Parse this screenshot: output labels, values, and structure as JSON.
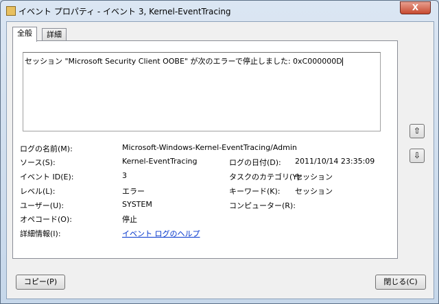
{
  "window": {
    "title": "イベント プロパティ - イベント 3, Kernel-EventTracing",
    "close": "X"
  },
  "tabs": [
    {
      "label": "全般"
    },
    {
      "label": "詳細"
    }
  ],
  "message": "セッション \"Microsoft Security Client OOBE\" が次のエラーで停止しました: 0xC000000D",
  "fields": {
    "log_name": {
      "label": "ログの名前(M):",
      "value": "Microsoft-Windows-Kernel-EventTracing/Admin"
    },
    "source": {
      "label": "ソース(S):",
      "value": "Kernel-EventTracing"
    },
    "logged": {
      "label": "ログの日付(D):",
      "value": "2011/10/14 23:35:09"
    },
    "event_id": {
      "label": "イベント ID(E):",
      "value": "3"
    },
    "task": {
      "label": "タスクのカテゴリ(Y):",
      "value": "セッション"
    },
    "level": {
      "label": "レベル(L):",
      "value": "エラー"
    },
    "keywords": {
      "label": "キーワード(K):",
      "value": "セッション"
    },
    "user": {
      "label": "ユーザー(U):",
      "value": "SYSTEM"
    },
    "computer": {
      "label": "コンピューター(R):",
      "value": ""
    },
    "opcode": {
      "label": "オペコード(O):",
      "value": "停止"
    },
    "more_info": {
      "label": "詳細情報(I):",
      "value": "イベント ログのヘルプ"
    }
  },
  "buttons": {
    "copy": "コピー(P)",
    "close": "閉じる(C)",
    "up": "⇧",
    "down": "⇩"
  }
}
